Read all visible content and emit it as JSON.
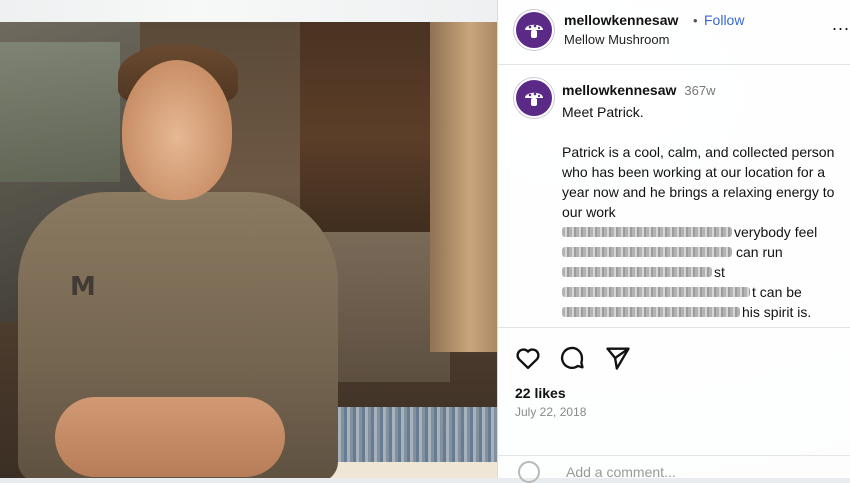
{
  "post": {
    "username": "mellowkennesaw",
    "follow_label": "Follow",
    "separator": "•",
    "location": "Mellow Mushroom",
    "more_label": "...",
    "caption": {
      "username": "mellowkennesaw",
      "age": "367w",
      "line1": "Meet Patrick.",
      "body": "Patrick is a cool, calm, and collected person who has been working at our location for a year now and he brings a relaxing energy to our work",
      "partial_lines": [
        "verybody feel",
        "can run",
        "st",
        "t can be",
        "his spirit is."
      ]
    },
    "likes": "22 likes",
    "date": "July 22, 2018",
    "comment_placeholder": "Add a comment..."
  },
  "photo": {
    "shirt_text": "M"
  },
  "colors": {
    "brand_avatar": "#5b2a86",
    "follow_link": "#3867d6"
  },
  "icons": [
    "mushroom-logo-icon",
    "heart-icon",
    "comment-icon",
    "share-icon",
    "emoji-icon",
    "more-icon"
  ]
}
